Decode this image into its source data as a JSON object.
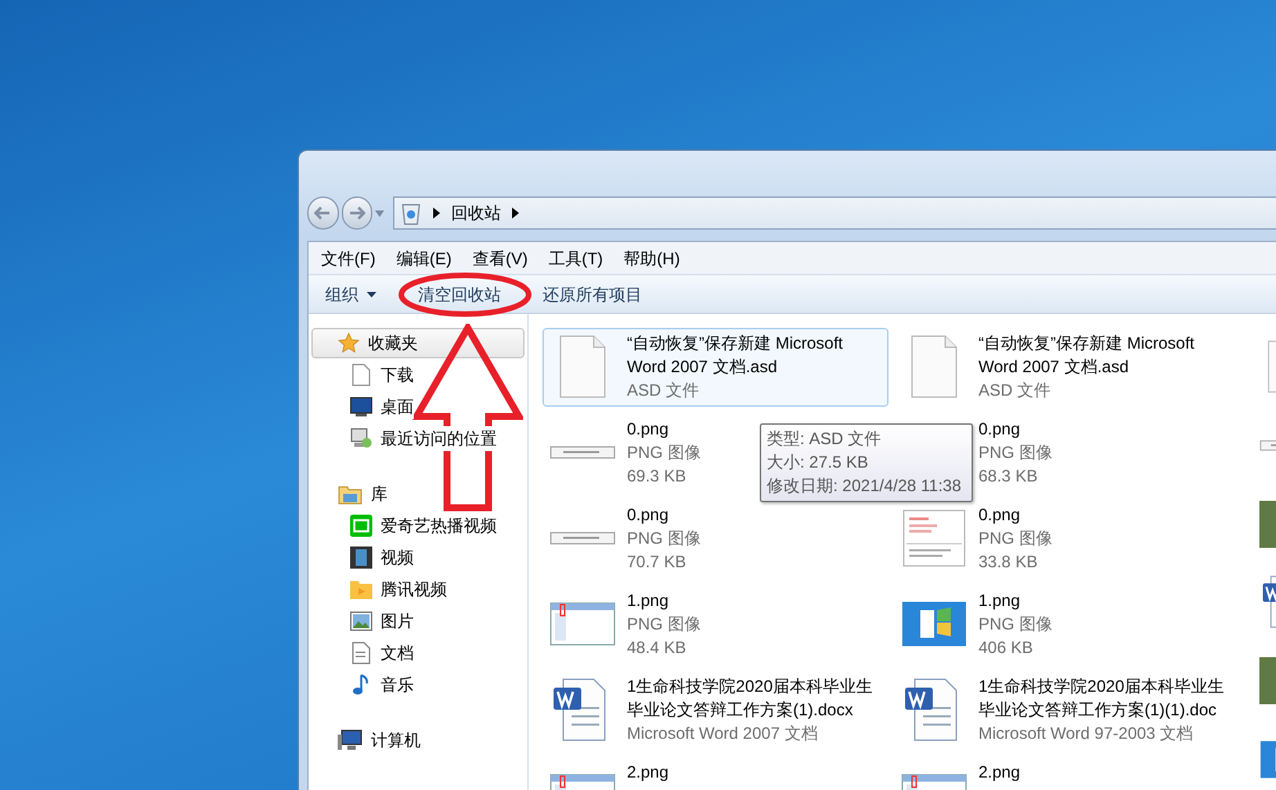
{
  "address": {
    "path": "回收站"
  },
  "menu": [
    "文件(F)",
    "编辑(E)",
    "查看(V)",
    "工具(T)",
    "帮助(H)"
  ],
  "toolbar": [
    {
      "label": "组织",
      "kind": "dropdown"
    },
    {
      "label": "清空回收站",
      "kind": "button"
    },
    {
      "label": "还原所有项目",
      "kind": "button"
    }
  ],
  "nav": [
    {
      "label": "收藏夹",
      "kind": "star",
      "selected": true,
      "children": [
        {
          "label": "下载",
          "kind": "page"
        },
        {
          "label": "桌面",
          "kind": "monitor"
        },
        {
          "label": "最近访问的位置",
          "kind": "recent"
        }
      ]
    },
    {
      "label": "库",
      "kind": "library",
      "selected": false,
      "children": [
        {
          "label": "爱奇艺热播视频",
          "kind": "iqiyi"
        },
        {
          "label": "视频",
          "kind": "film"
        },
        {
          "label": "腾讯视频",
          "kind": "tencent"
        },
        {
          "label": "图片",
          "kind": "picture"
        },
        {
          "label": "文档",
          "kind": "document"
        },
        {
          "label": "音乐",
          "kind": "music"
        }
      ]
    },
    {
      "label": "计算机",
      "kind": "computer",
      "selected": false
    }
  ],
  "files": [
    {
      "name": "“自动恢复”保存新建 Microsoft Word 2007 文档.asd",
      "type": "ASD 文件",
      "kind": "blank",
      "selected": true
    },
    {
      "name": "“自动恢复”保存新建 Microsoft Word 2007 文档.asd",
      "type": "ASD 文件",
      "kind": "blank",
      "selected": false
    },
    {
      "name": "0.png",
      "type": "PNG 图像",
      "size": "69.3 KB",
      "kind": "strip",
      "selected": false
    },
    {
      "name": "0.png",
      "type": "PNG 图像",
      "size": "68.3 KB",
      "kind": "strip",
      "selected": false
    },
    {
      "name": "0.png",
      "type": "PNG 图像",
      "size": "70.7 KB",
      "kind": "strip",
      "selected": false
    },
    {
      "name": "0.png",
      "type": "PNG 图像",
      "size": "33.8 KB",
      "kind": "letter",
      "selected": false
    },
    {
      "name": "1.png",
      "type": "PNG 图像",
      "size": "48.4 KB",
      "kind": "screen",
      "selected": false
    },
    {
      "name": "1.png",
      "type": "PNG 图像",
      "size": "406 KB",
      "kind": "desktop",
      "selected": false
    },
    {
      "name": "1生命科技学院2020届本科毕业生毕业论文答辩工作方案(1).docx",
      "type": "Microsoft Word 2007 文档",
      "kind": "word",
      "selected": false
    },
    {
      "name": "1生命科技学院2020届本科毕业生毕业论文答辩工作方案(1)(1).doc",
      "type": "Microsoft Word 97-2003 文档",
      "kind": "word",
      "selected": false
    },
    {
      "name": "2.png",
      "kind": "screen",
      "selected": false
    },
    {
      "name": "2.png",
      "kind": "screen",
      "selected": false
    }
  ],
  "edge_items": [
    {
      "kind": "blank"
    },
    {
      "kind": "strip"
    },
    {
      "kind": "photo"
    },
    {
      "kind": "word"
    },
    {
      "kind": "photo"
    },
    {
      "kind": "desktop"
    }
  ],
  "tooltip": [
    "类型: ASD 文件",
    "大小: 27.5 KB",
    "修改日期: 2021/4/28 11:38"
  ]
}
